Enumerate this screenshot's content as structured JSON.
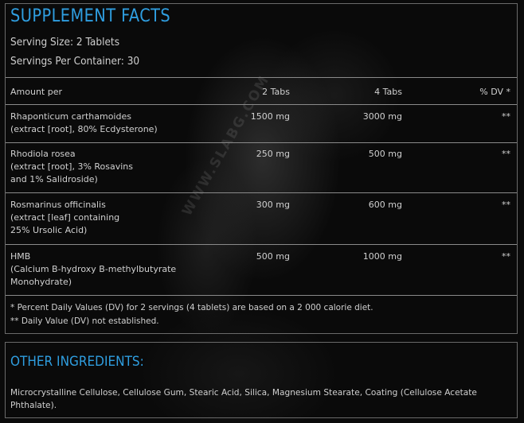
{
  "watermark": "WWW.SLABG.COM",
  "facts": {
    "title": "SUPPLEMENT FACTS",
    "serving_size": "Serving Size: 2 Tablets",
    "servings_per_container": "Servings Per Container: 30",
    "header": {
      "name": "Amount per",
      "col2": "2 Tabs",
      "col4": "4 Tabs",
      "dv": "% DV *"
    },
    "rows": [
      {
        "name1": "Rhaponticum carthamoides",
        "name2": "(extract [root], 80% Ecdysterone)",
        "name3": "",
        "col2": "1500 mg",
        "col4": "3000 mg",
        "dv": "**"
      },
      {
        "name1": "Rhodiola rosea",
        "name2": "(extract [root], 3% Rosavins",
        "name3": "and 1% Salidroside)",
        "col2": "250 mg",
        "col4": "500 mg",
        "dv": "**"
      },
      {
        "name1": "Rosmarinus officinalis",
        "name2": "(extract [leaf] containing",
        "name3": "25% Ursolic Acid)",
        "col2": "300 mg",
        "col4": "600 mg",
        "dv": "**"
      },
      {
        "name1": "HMB",
        "name2": "(Calcium B-hydroxy B-methylbutyrate",
        "name3": "Monohydrate)",
        "col2": "500 mg",
        "col4": "1000 mg",
        "dv": "**"
      }
    ],
    "footnote1": "* Percent Daily Values (DV) for 2 servings (4 tablets) are based on a 2 000 calorie diet.",
    "footnote2": "** Daily Value (DV) not established."
  },
  "other": {
    "title": "OTHER INGREDIENTS:",
    "text": "Microcrystalline Cellulose, Cellulose Gum, Stearic Acid, Silica, Magnesium Stearate, Coating (Cellulose Acetate Phthalate)."
  },
  "colors": {
    "accent": "#2f9ee0",
    "text": "#d0d0d0",
    "border": "#6a6a6a",
    "background": "#0a0a0a"
  }
}
